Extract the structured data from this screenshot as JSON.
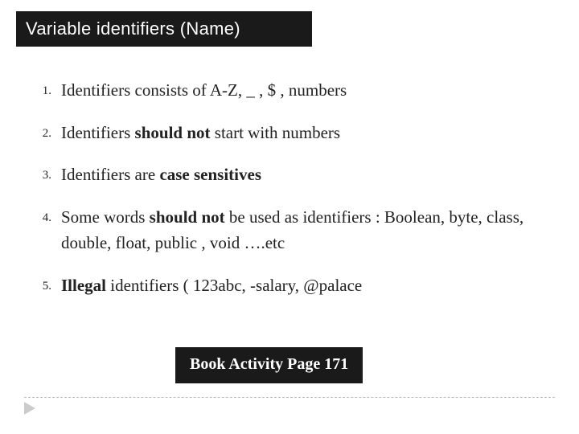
{
  "title": "Variable identifiers (Name)",
  "items": [
    {
      "num": "1.",
      "parts": [
        {
          "text": "Identifiers consists of A-Z, _ , $ , numbers",
          "bold": false
        }
      ]
    },
    {
      "num": "2.",
      "parts": [
        {
          "text": "Identifiers ",
          "bold": false
        },
        {
          "text": "should not",
          "bold": true
        },
        {
          "text": " start with numbers",
          "bold": false
        }
      ]
    },
    {
      "num": "3.",
      "parts": [
        {
          "text": "Identifiers are ",
          "bold": false
        },
        {
          "text": "case sensitives",
          "bold": true
        }
      ]
    },
    {
      "num": "4.",
      "parts": [
        {
          "text": "Some words ",
          "bold": false
        },
        {
          "text": "should not",
          "bold": true
        },
        {
          "text": " be used as identifiers : Boolean, byte, class, double, float, public , void ….etc",
          "bold": false
        }
      ]
    },
    {
      "num": "5.",
      "parts": [
        {
          "text": "Illegal",
          "bold": true
        },
        {
          "text": " identifiers ( 123abc, -salary, @palace",
          "bold": false
        }
      ]
    }
  ],
  "badge": "Book Activity Page 171"
}
